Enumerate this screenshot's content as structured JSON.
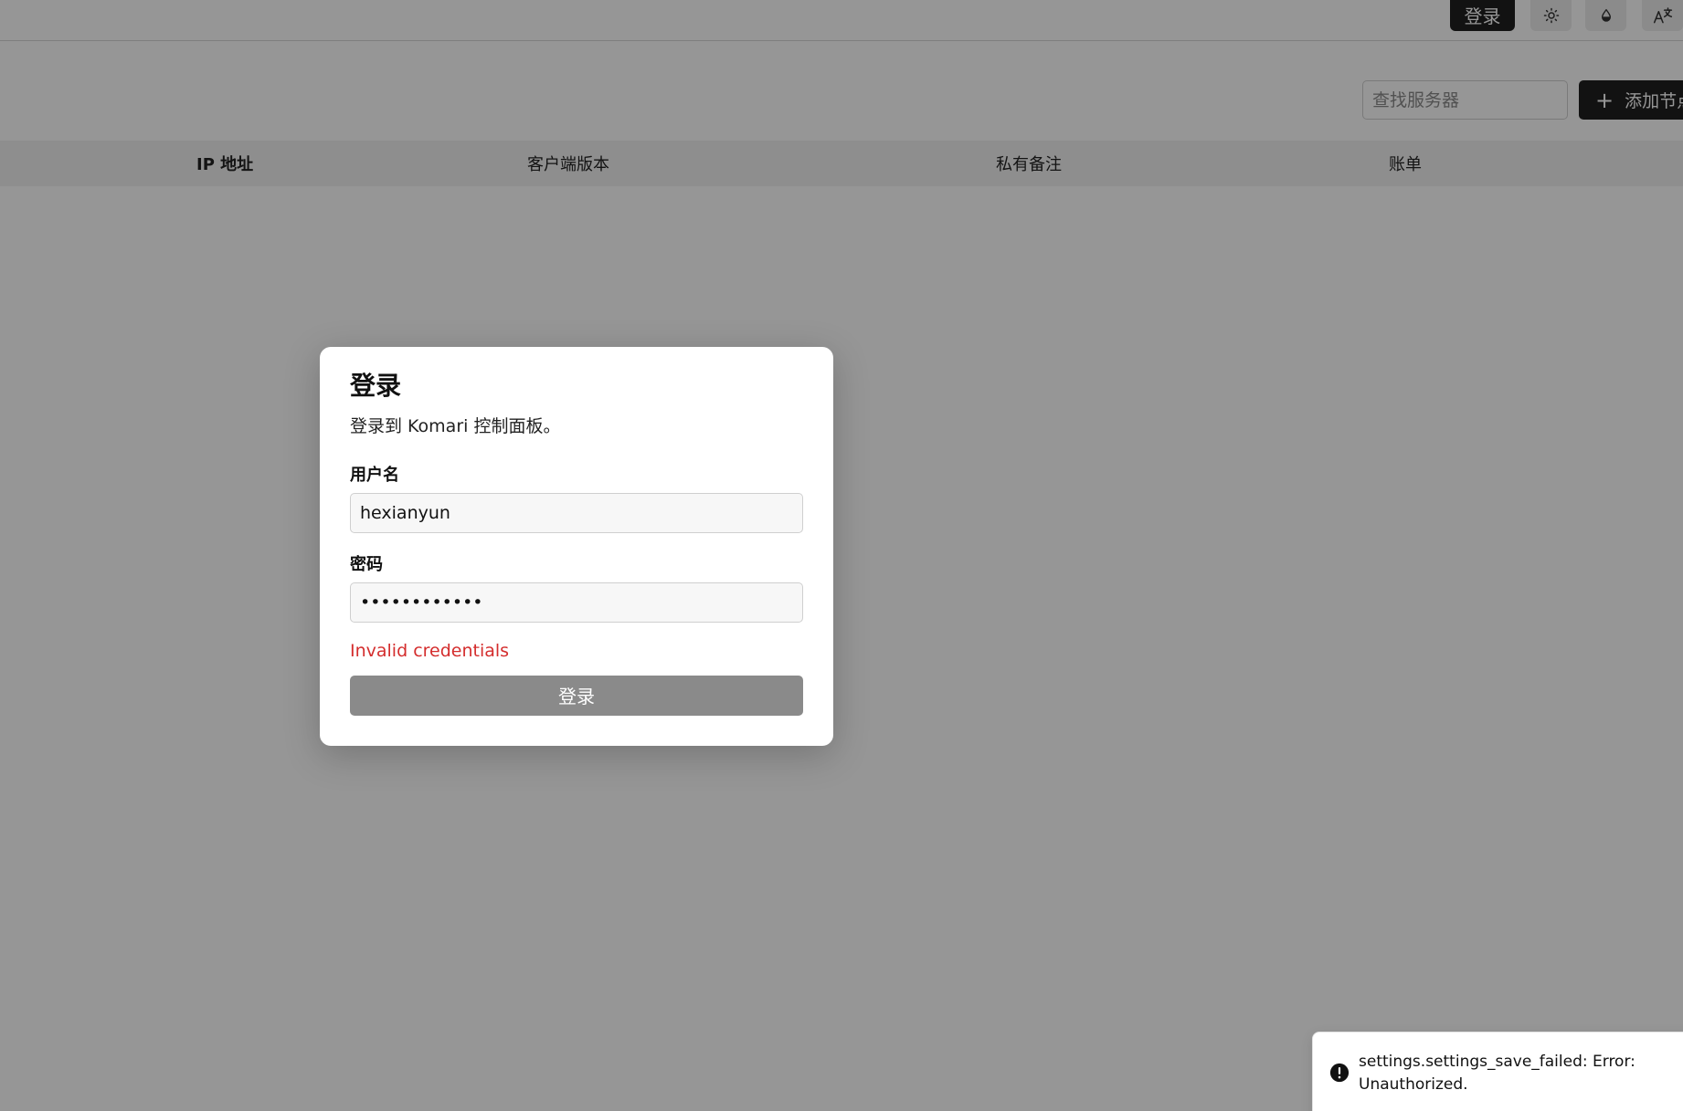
{
  "header": {
    "login_label": "登录",
    "icons": [
      "sun-icon",
      "droplet-icon",
      "translate-icon"
    ]
  },
  "toolbar": {
    "search_placeholder": "查找服务器",
    "add_node_label": "添加节点"
  },
  "table": {
    "columns": [
      "IP 地址",
      "客户端版本",
      "私有备注",
      "账单"
    ]
  },
  "dialog": {
    "title": "登录",
    "description": "登录到 Komari 控制面板。",
    "username_label": "用户名",
    "username_value": "hexianyun",
    "password_label": "密码",
    "password_value": "************",
    "error": "Invalid credentials",
    "submit_label": "登录"
  },
  "toast": {
    "message": "settings.settings_save_failed: Error: Unauthorized.",
    "icon": "alert-circle-icon"
  },
  "colors": {
    "primary_dark": "#1f1f1f",
    "error_red": "#d42d2d",
    "overlay": "rgba(0,0,0,0.41)"
  }
}
